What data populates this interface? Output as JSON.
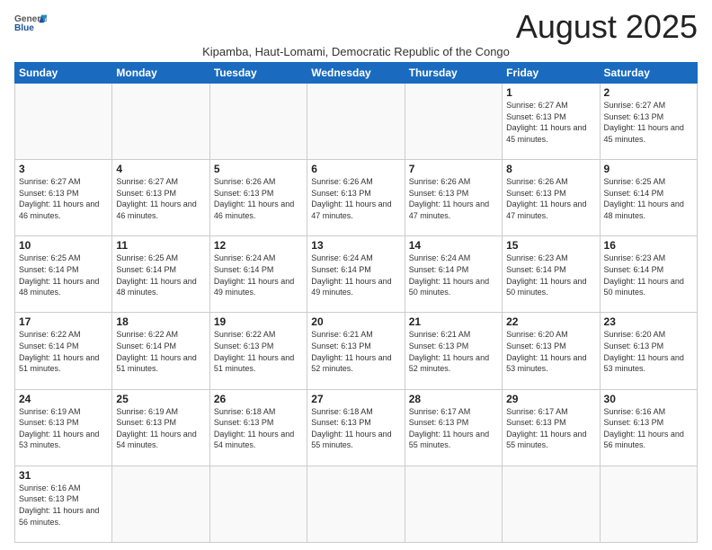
{
  "logo": {
    "text_general": "General",
    "text_blue": "Blue"
  },
  "header": {
    "month": "August 2025",
    "subtitle": "Kipamba, Haut-Lomami, Democratic Republic of the Congo"
  },
  "weekdays": [
    "Sunday",
    "Monday",
    "Tuesday",
    "Wednesday",
    "Thursday",
    "Friday",
    "Saturday"
  ],
  "weeks": [
    [
      {
        "day": "",
        "info": ""
      },
      {
        "day": "",
        "info": ""
      },
      {
        "day": "",
        "info": ""
      },
      {
        "day": "",
        "info": ""
      },
      {
        "day": "",
        "info": ""
      },
      {
        "day": "1",
        "info": "Sunrise: 6:27 AM\nSunset: 6:13 PM\nDaylight: 11 hours and 45 minutes."
      },
      {
        "day": "2",
        "info": "Sunrise: 6:27 AM\nSunset: 6:13 PM\nDaylight: 11 hours and 45 minutes."
      }
    ],
    [
      {
        "day": "3",
        "info": "Sunrise: 6:27 AM\nSunset: 6:13 PM\nDaylight: 11 hours and 46 minutes."
      },
      {
        "day": "4",
        "info": "Sunrise: 6:27 AM\nSunset: 6:13 PM\nDaylight: 11 hours and 46 minutes."
      },
      {
        "day": "5",
        "info": "Sunrise: 6:26 AM\nSunset: 6:13 PM\nDaylight: 11 hours and 46 minutes."
      },
      {
        "day": "6",
        "info": "Sunrise: 6:26 AM\nSunset: 6:13 PM\nDaylight: 11 hours and 47 minutes."
      },
      {
        "day": "7",
        "info": "Sunrise: 6:26 AM\nSunset: 6:13 PM\nDaylight: 11 hours and 47 minutes."
      },
      {
        "day": "8",
        "info": "Sunrise: 6:26 AM\nSunset: 6:13 PM\nDaylight: 11 hours and 47 minutes."
      },
      {
        "day": "9",
        "info": "Sunrise: 6:25 AM\nSunset: 6:14 PM\nDaylight: 11 hours and 48 minutes."
      }
    ],
    [
      {
        "day": "10",
        "info": "Sunrise: 6:25 AM\nSunset: 6:14 PM\nDaylight: 11 hours and 48 minutes."
      },
      {
        "day": "11",
        "info": "Sunrise: 6:25 AM\nSunset: 6:14 PM\nDaylight: 11 hours and 48 minutes."
      },
      {
        "day": "12",
        "info": "Sunrise: 6:24 AM\nSunset: 6:14 PM\nDaylight: 11 hours and 49 minutes."
      },
      {
        "day": "13",
        "info": "Sunrise: 6:24 AM\nSunset: 6:14 PM\nDaylight: 11 hours and 49 minutes."
      },
      {
        "day": "14",
        "info": "Sunrise: 6:24 AM\nSunset: 6:14 PM\nDaylight: 11 hours and 50 minutes."
      },
      {
        "day": "15",
        "info": "Sunrise: 6:23 AM\nSunset: 6:14 PM\nDaylight: 11 hours and 50 minutes."
      },
      {
        "day": "16",
        "info": "Sunrise: 6:23 AM\nSunset: 6:14 PM\nDaylight: 11 hours and 50 minutes."
      }
    ],
    [
      {
        "day": "17",
        "info": "Sunrise: 6:22 AM\nSunset: 6:14 PM\nDaylight: 11 hours and 51 minutes."
      },
      {
        "day": "18",
        "info": "Sunrise: 6:22 AM\nSunset: 6:14 PM\nDaylight: 11 hours and 51 minutes."
      },
      {
        "day": "19",
        "info": "Sunrise: 6:22 AM\nSunset: 6:13 PM\nDaylight: 11 hours and 51 minutes."
      },
      {
        "day": "20",
        "info": "Sunrise: 6:21 AM\nSunset: 6:13 PM\nDaylight: 11 hours and 52 minutes."
      },
      {
        "day": "21",
        "info": "Sunrise: 6:21 AM\nSunset: 6:13 PM\nDaylight: 11 hours and 52 minutes."
      },
      {
        "day": "22",
        "info": "Sunrise: 6:20 AM\nSunset: 6:13 PM\nDaylight: 11 hours and 53 minutes."
      },
      {
        "day": "23",
        "info": "Sunrise: 6:20 AM\nSunset: 6:13 PM\nDaylight: 11 hours and 53 minutes."
      }
    ],
    [
      {
        "day": "24",
        "info": "Sunrise: 6:19 AM\nSunset: 6:13 PM\nDaylight: 11 hours and 53 minutes."
      },
      {
        "day": "25",
        "info": "Sunrise: 6:19 AM\nSunset: 6:13 PM\nDaylight: 11 hours and 54 minutes."
      },
      {
        "day": "26",
        "info": "Sunrise: 6:18 AM\nSunset: 6:13 PM\nDaylight: 11 hours and 54 minutes."
      },
      {
        "day": "27",
        "info": "Sunrise: 6:18 AM\nSunset: 6:13 PM\nDaylight: 11 hours and 55 minutes."
      },
      {
        "day": "28",
        "info": "Sunrise: 6:17 AM\nSunset: 6:13 PM\nDaylight: 11 hours and 55 minutes."
      },
      {
        "day": "29",
        "info": "Sunrise: 6:17 AM\nSunset: 6:13 PM\nDaylight: 11 hours and 55 minutes."
      },
      {
        "day": "30",
        "info": "Sunrise: 6:16 AM\nSunset: 6:13 PM\nDaylight: 11 hours and 56 minutes."
      }
    ],
    [
      {
        "day": "31",
        "info": "Sunrise: 6:16 AM\nSunset: 6:13 PM\nDaylight: 11 hours and 56 minutes."
      },
      {
        "day": "",
        "info": ""
      },
      {
        "day": "",
        "info": ""
      },
      {
        "day": "",
        "info": ""
      },
      {
        "day": "",
        "info": ""
      },
      {
        "day": "",
        "info": ""
      },
      {
        "day": "",
        "info": ""
      }
    ]
  ]
}
